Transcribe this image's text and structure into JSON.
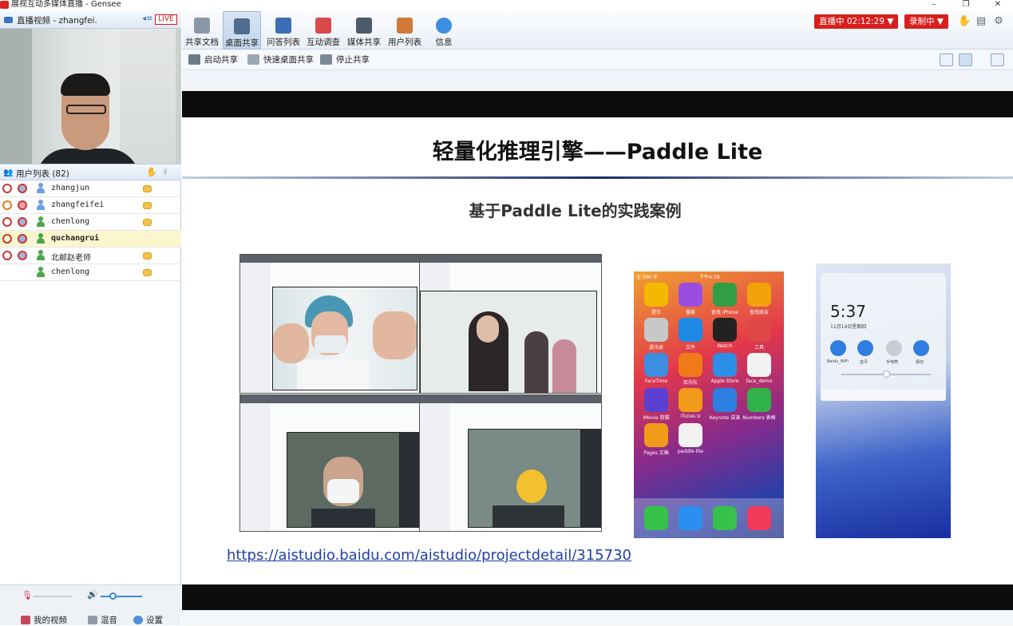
{
  "window": {
    "title": "展视互动多媒体直播 - Gensee",
    "controls": [
      "–",
      "❐",
      "✕"
    ]
  },
  "left_panel": {
    "video_header": {
      "label": "直播视频 - zhangfei.",
      "live_badge": "LIVE"
    },
    "user_list_header": {
      "label": "用户列表 (82)"
    },
    "users": [
      {
        "name": "zhangjun",
        "highlight": false,
        "bold": false,
        "chat": true,
        "avatar": "blue"
      },
      {
        "name": "zhangfeifei",
        "highlight": false,
        "bold": false,
        "chat": true,
        "avatar": "blue"
      },
      {
        "name": "chenlong",
        "highlight": false,
        "bold": false,
        "chat": true,
        "avatar": "green"
      },
      {
        "name": "quchangrui",
        "highlight": true,
        "bold": true,
        "chat": false,
        "avatar": "green"
      },
      {
        "name": "北邮赵老师",
        "highlight": false,
        "bold": false,
        "chat": true,
        "avatar": "green"
      },
      {
        "name": "chenlong",
        "highlight": false,
        "bold": false,
        "chat": true,
        "avatar": "green"
      }
    ],
    "bottom": {
      "my_video": "我的视频",
      "mix": "混音",
      "settings": "设置"
    }
  },
  "toolbar": {
    "items": [
      {
        "label": "共享文档",
        "icon": "document-icon",
        "color": "#8a98a8"
      },
      {
        "label": "桌面共享",
        "icon": "desktop-share-icon",
        "color": "#4f6d8f",
        "active": true
      },
      {
        "label": "问答列表",
        "icon": "qa-list-icon",
        "color": "#3a6fb5"
      },
      {
        "label": "互动调查",
        "icon": "survey-icon",
        "color": "#d9484a"
      },
      {
        "label": "媒体共享",
        "icon": "media-share-icon",
        "color": "#4c5a6a"
      },
      {
        "label": "用户列表",
        "icon": "user-list-icon",
        "color": "#d07a3a"
      },
      {
        "label": "信息",
        "icon": "info-icon",
        "color": "#3d8ee0"
      }
    ],
    "live_status": "直播中 02:12:29 ▼",
    "record_status": "录制中 ▼"
  },
  "subbar": {
    "start_share": "启动共享",
    "quick_share": "快速桌面共享",
    "stop_share": "停止共享"
  },
  "slide": {
    "title": "轻量化推理引擎——Paddle Lite",
    "subtitle": "基于Paddle Lite的实践案例",
    "link": "https://aistudio.baidu.com/aistudio/projectdetail/315730",
    "phone1": {
      "status_left": "无 SIM 卡",
      "status_time": "下午4:39",
      "apps": [
        {
          "label": "提示",
          "color": "#f5b800"
        },
        {
          "label": "播客",
          "color": "#9b4de0"
        },
        {
          "label": "查找 iPhone",
          "color": "#2f9e44"
        },
        {
          "label": "查找朋友",
          "color": "#f2a20a"
        },
        {
          "label": "通讯录",
          "color": "#c8c8c8"
        },
        {
          "label": "文件",
          "color": "#1e88e5"
        },
        {
          "label": "Watch",
          "color": "#222222"
        },
        {
          "label": "工具",
          "color": "#e04848"
        },
        {
          "label": "FaceTime",
          "color": "#3d8ee0"
        },
        {
          "label": "库乐队",
          "color": "#f07a1a"
        },
        {
          "label": "Apple Store",
          "color": "#2b8fe8"
        },
        {
          "label": "face_demo",
          "color": "#f2f2f2"
        },
        {
          "label": "iMovie 剪辑",
          "color": "#5b3fd1"
        },
        {
          "label": "iTunes U",
          "color": "#f29a1a"
        },
        {
          "label": "Keynote 讲演",
          "color": "#2b7fe0"
        },
        {
          "label": "Numbers 表格",
          "color": "#2fb24a"
        },
        {
          "label": "Pages 文稿",
          "color": "#f29a1a"
        },
        {
          "label": "paddle-lite",
          "color": "#f2f2f2"
        }
      ],
      "dock": [
        {
          "color": "#36c24a"
        },
        {
          "color": "#2a8ff0"
        },
        {
          "color": "#36c24a"
        },
        {
          "color": "#f23a5a"
        }
      ]
    },
    "phone2": {
      "time": "5:37",
      "date": "11月14日星期四",
      "toggles": [
        "Baidu_WiFi",
        "蓝牙",
        "手电筒",
        "振动"
      ]
    }
  }
}
